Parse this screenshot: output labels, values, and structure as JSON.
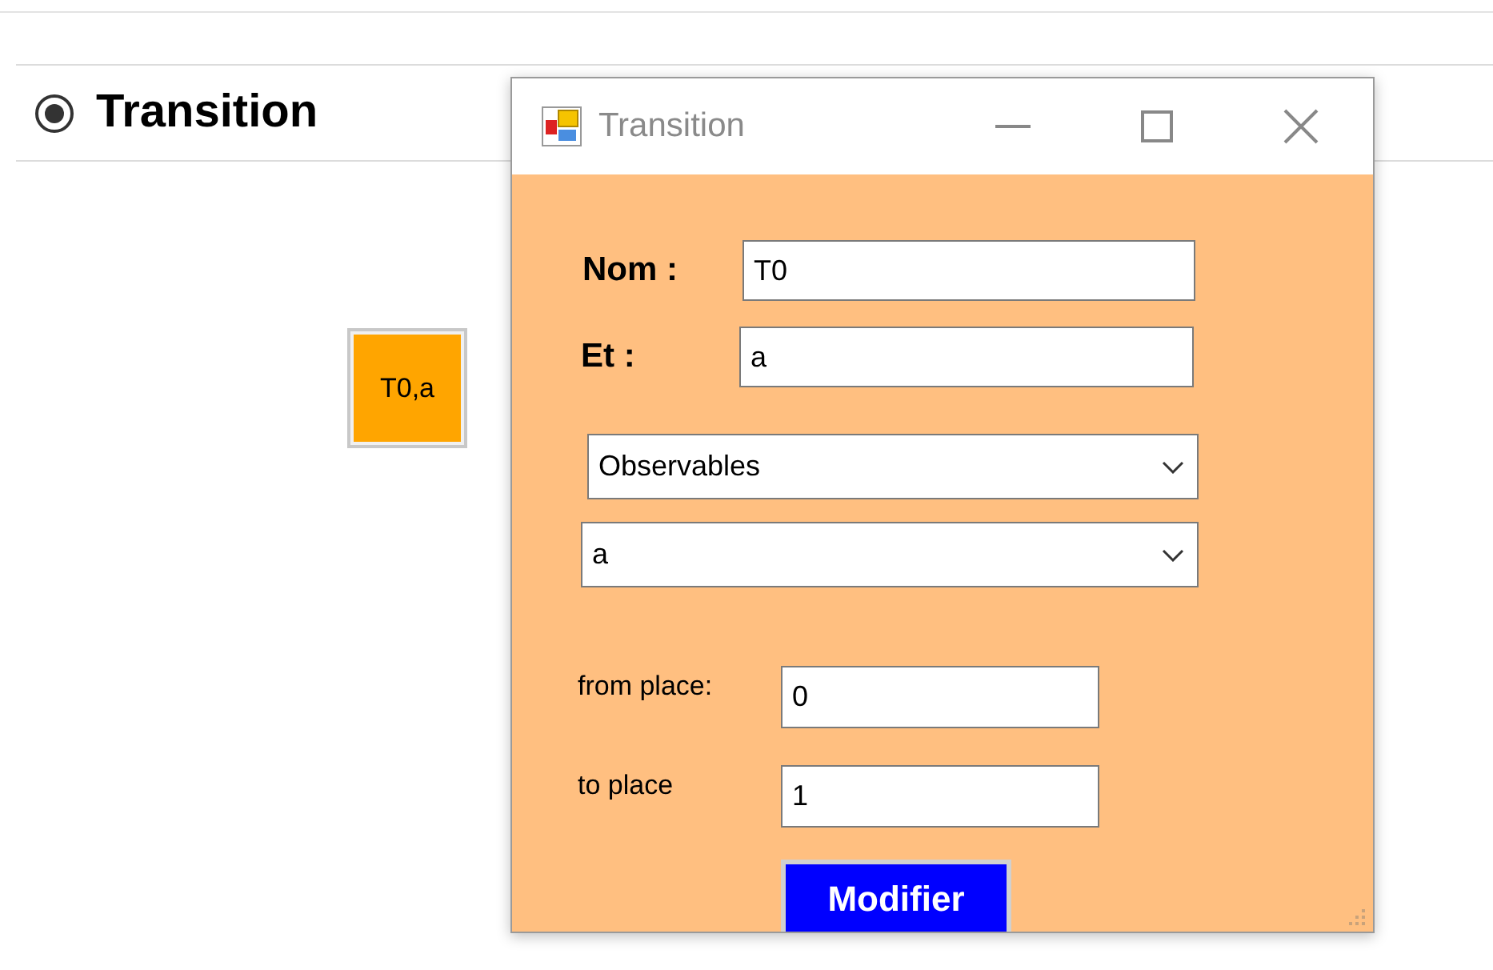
{
  "panel": {
    "radio": {
      "label": "Transition",
      "selected": true
    }
  },
  "canvas": {
    "nodes": [
      {
        "label": "T0,a"
      }
    ]
  },
  "dialog": {
    "title": "Transition",
    "fields": [
      {
        "label": "Nom :",
        "value": "T0"
      },
      {
        "label": "Et :",
        "value": "a"
      }
    ],
    "dropdowns": [
      {
        "value": "Observables"
      },
      {
        "value": "a"
      }
    ],
    "places": [
      {
        "label": "from place:",
        "value": "0"
      },
      {
        "label": "to place",
        "value": "1"
      }
    ],
    "button": "Modifier"
  }
}
